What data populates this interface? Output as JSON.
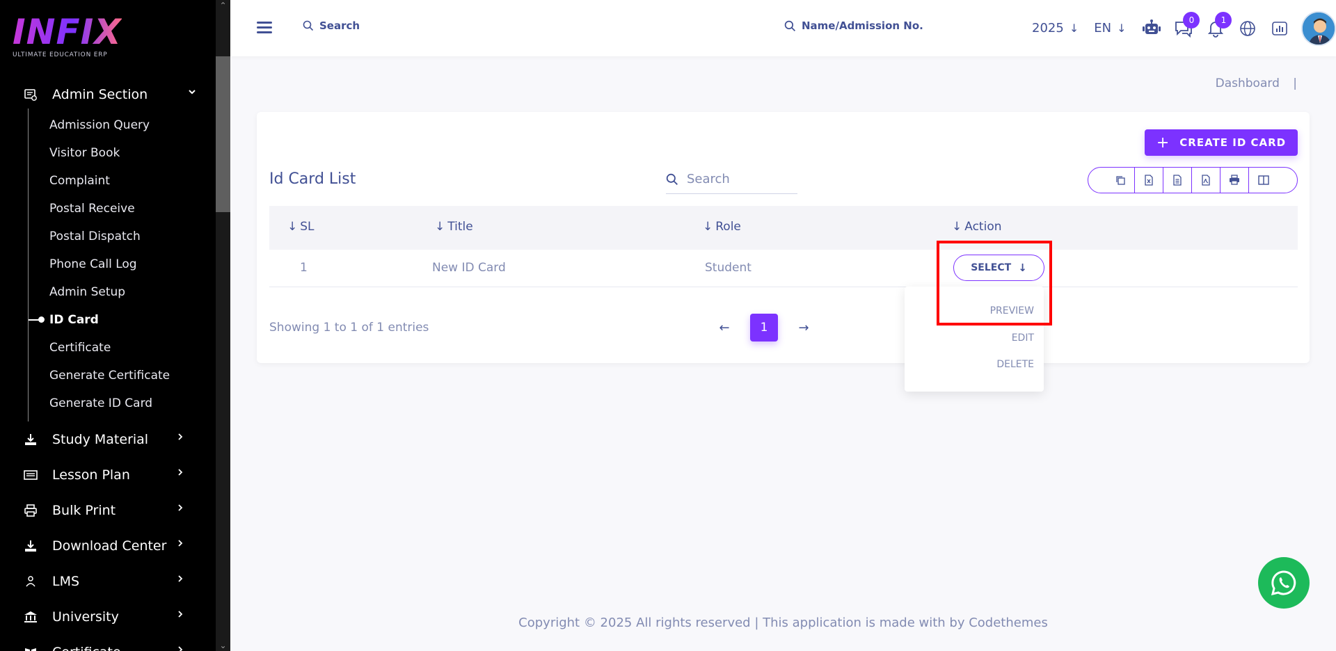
{
  "brand": {
    "logo_text": "INFIX",
    "tagline": "ULTIMATE EDUCATION ERP"
  },
  "sidebar": {
    "section": {
      "label": "Admin Section",
      "icon": "admin-section-icon"
    },
    "sub_items": [
      {
        "label": "Admission Query",
        "active": false
      },
      {
        "label": "Visitor Book",
        "active": false
      },
      {
        "label": "Complaint",
        "active": false
      },
      {
        "label": "Postal Receive",
        "active": false
      },
      {
        "label": "Postal Dispatch",
        "active": false
      },
      {
        "label": "Phone Call Log",
        "active": false
      },
      {
        "label": "Admin Setup",
        "active": false
      },
      {
        "label": "ID Card",
        "active": true
      },
      {
        "label": "Certificate",
        "active": false
      },
      {
        "label": "Generate Certificate",
        "active": false
      },
      {
        "label": "Generate ID Card",
        "active": false
      }
    ],
    "items": [
      {
        "label": "Study Material",
        "icon": "download-icon"
      },
      {
        "label": "Lesson Plan",
        "icon": "lesson-plan-icon"
      },
      {
        "label": "Bulk Print",
        "icon": "printer-icon"
      },
      {
        "label": "Download Center",
        "icon": "download-icon"
      },
      {
        "label": "LMS",
        "icon": "lms-icon"
      },
      {
        "label": "University",
        "icon": "university-icon"
      },
      {
        "label": "Certificate",
        "icon": "certificate-icon"
      }
    ]
  },
  "header": {
    "search_label": "Search",
    "name_search_label": "Name/Admission No.",
    "year": "2025",
    "language": "EN",
    "messages_count": "0",
    "notifications_count": "1"
  },
  "breadcrumb": {
    "item": "Dashboard",
    "separator": "|"
  },
  "card": {
    "title": "Id Card List",
    "create_button": "CREATE ID CARD",
    "search_placeholder": "Search",
    "export_icons": [
      "copy-icon",
      "excel-icon",
      "csv-icon",
      "pdf-icon",
      "print-icon",
      "columns-icon"
    ],
    "columns": [
      "SL",
      "Title",
      "Role",
      "Action"
    ],
    "rows": [
      {
        "sl": "1",
        "title": "New ID Card",
        "role": "Student",
        "action": "SELECT"
      }
    ],
    "action_menu": [
      "PREVIEW",
      "EDIT",
      "DELETE"
    ],
    "showing_text": "Showing 1 to 1 of 1 entries",
    "current_page": "1"
  },
  "footer": {
    "text": "Copyright © 2025 All rights reserved | This application is made with by Codethemes"
  },
  "colors": {
    "primary": "#7c32ff",
    "text": "#415094",
    "muted": "#828bb2",
    "sidebar_bg": "#000000",
    "highlight": "#ff0000",
    "whatsapp": "#1dba5a"
  }
}
